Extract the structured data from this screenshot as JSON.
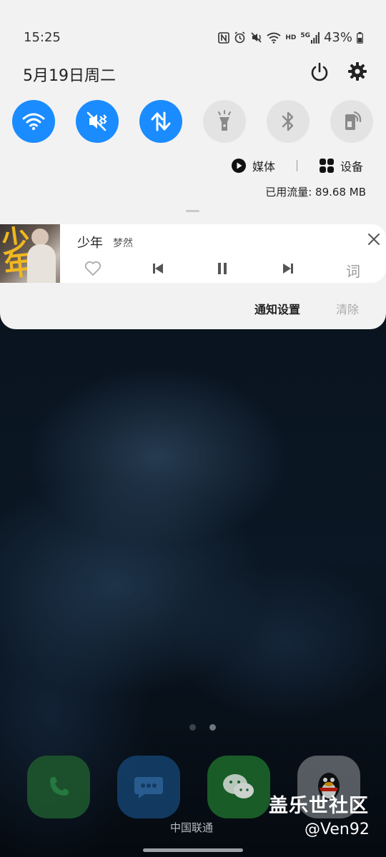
{
  "status_bar": {
    "time": "15:25",
    "battery": "43%",
    "icons": [
      "nfc-icon",
      "alarm-icon",
      "mute-icon",
      "wifi-icon",
      "hd-icon",
      "5g-signal-icon",
      "battery-icon"
    ],
    "hd_label": "HD",
    "net_label": "5G"
  },
  "shade": {
    "date": "5月19日周二",
    "quick_settings": [
      {
        "name": "wifi",
        "state": "on"
      },
      {
        "name": "vibrate",
        "state": "on"
      },
      {
        "name": "mobile-data",
        "state": "on"
      },
      {
        "name": "flashlight",
        "state": "off"
      },
      {
        "name": "bluetooth",
        "state": "off"
      },
      {
        "name": "screen-mirror",
        "state": "off"
      }
    ],
    "media_label": "媒体",
    "devices_label": "设备",
    "data_usage": "已用流量: 89.68 MB",
    "notif_settings": "通知设置",
    "clear": "清除"
  },
  "music": {
    "title": "少年",
    "artist": "梦然",
    "lyric_button": "词",
    "album_text": [
      "少",
      "年"
    ]
  },
  "home": {
    "carrier": "中国联通",
    "dock": [
      "phone",
      "messages",
      "wechat",
      "qq"
    ]
  },
  "watermark": {
    "line1": "盖乐世社区",
    "line2": "@Ven92"
  },
  "colors": {
    "accent": "#1a8cff",
    "shade_bg": "#f2f2f2"
  }
}
